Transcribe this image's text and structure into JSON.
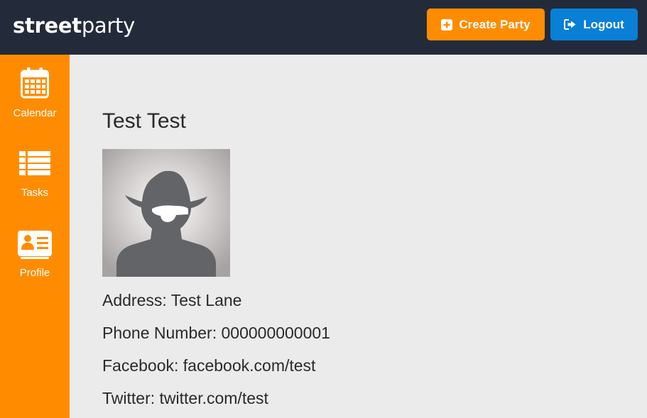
{
  "header": {
    "brand_bold": "street",
    "brand_light": "party",
    "create_label": "Create Party",
    "logout_label": "Logout"
  },
  "sidebar": {
    "items": [
      {
        "label": "Calendar",
        "icon": "calendar-icon"
      },
      {
        "label": "Tasks",
        "icon": "list-icon"
      },
      {
        "label": "Profile",
        "icon": "id-card-icon"
      }
    ]
  },
  "profile": {
    "name": "Test Test",
    "avatar_icon": "pirate-avatar-icon",
    "address": "Address: Test Lane",
    "phone": "Phone Number: 000000000001",
    "facebook": "Facebook: facebook.com/test",
    "twitter": "Twitter: twitter.com/test"
  },
  "colors": {
    "header_bg": "#232b3a",
    "accent_orange": "#ff8c00",
    "logout_blue": "#0a7fd6",
    "page_bg": "#ebebeb"
  }
}
